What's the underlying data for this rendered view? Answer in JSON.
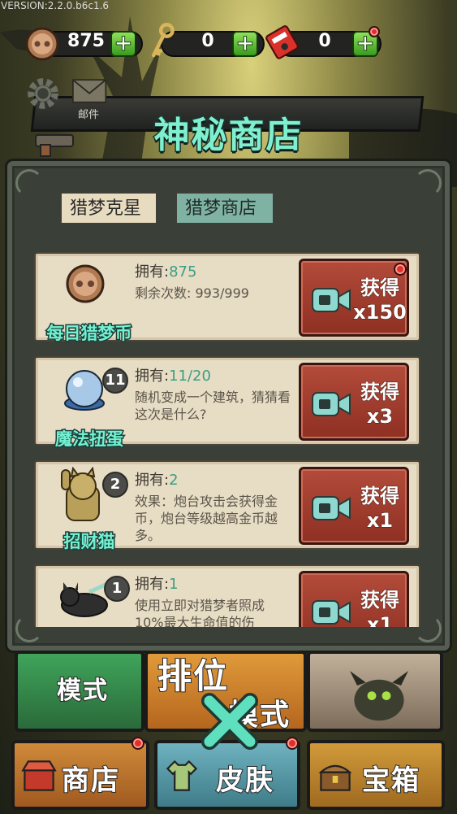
{
  "version": "VERSION:2.2.0.b6c1.6",
  "currencies": [
    {
      "name": "dream-coin",
      "value": "875",
      "plus": "+"
    },
    {
      "name": "key",
      "value": "0",
      "plus": "+"
    },
    {
      "name": "ticket",
      "value": "0",
      "plus": "+"
    }
  ],
  "side": {
    "mail_label": "邮件"
  },
  "title": "神秘商店",
  "tabs": [
    {
      "label": "猎梦克星",
      "selected": false
    },
    {
      "label": "猎梦商店",
      "selected": true
    }
  ],
  "own_prefix": "拥有:",
  "items": [
    {
      "name": "每日猎梦币",
      "icon": "coin-icon",
      "owned": "875",
      "desc": "剩余次数: 993/999",
      "badge": "",
      "button": {
        "label": "获得",
        "qty": "x150",
        "has_dot": true
      }
    },
    {
      "name": "魔法扭蛋",
      "icon": "gacha-ball-icon",
      "owned": "11/20",
      "desc": "随机变成一个建筑，猜猜看这次是什么?",
      "badge": "11",
      "button": {
        "label": "获得",
        "qty": "x3",
        "has_dot": false
      }
    },
    {
      "name": "招财猫",
      "icon": "lucky-cat-icon",
      "owned": "2",
      "desc": "效果：炮台攻击会获得金币，炮台等级越高金币越多。",
      "badge": "2",
      "button": {
        "label": "获得",
        "qty": "x1",
        "has_dot": false
      }
    },
    {
      "name": "",
      "icon": "black-cat-icon",
      "owned": "1",
      "desc": "使用立即对猎梦者照成10%最大生命值的伤",
      "badge": "1",
      "button": {
        "label": "获得",
        "qty": "x1",
        "has_dot": false
      }
    }
  ],
  "bottom": {
    "tile_mode_left": "模式",
    "tile_rank": "排位",
    "tile_rank_mode": "模式",
    "nav": [
      "商店",
      "皮肤",
      "宝箱"
    ]
  },
  "colors": {
    "title": "#7ff0cf",
    "button": "#9e3b2d",
    "plus": "#4fb52b",
    "video_icon": "#8fd8cf"
  }
}
